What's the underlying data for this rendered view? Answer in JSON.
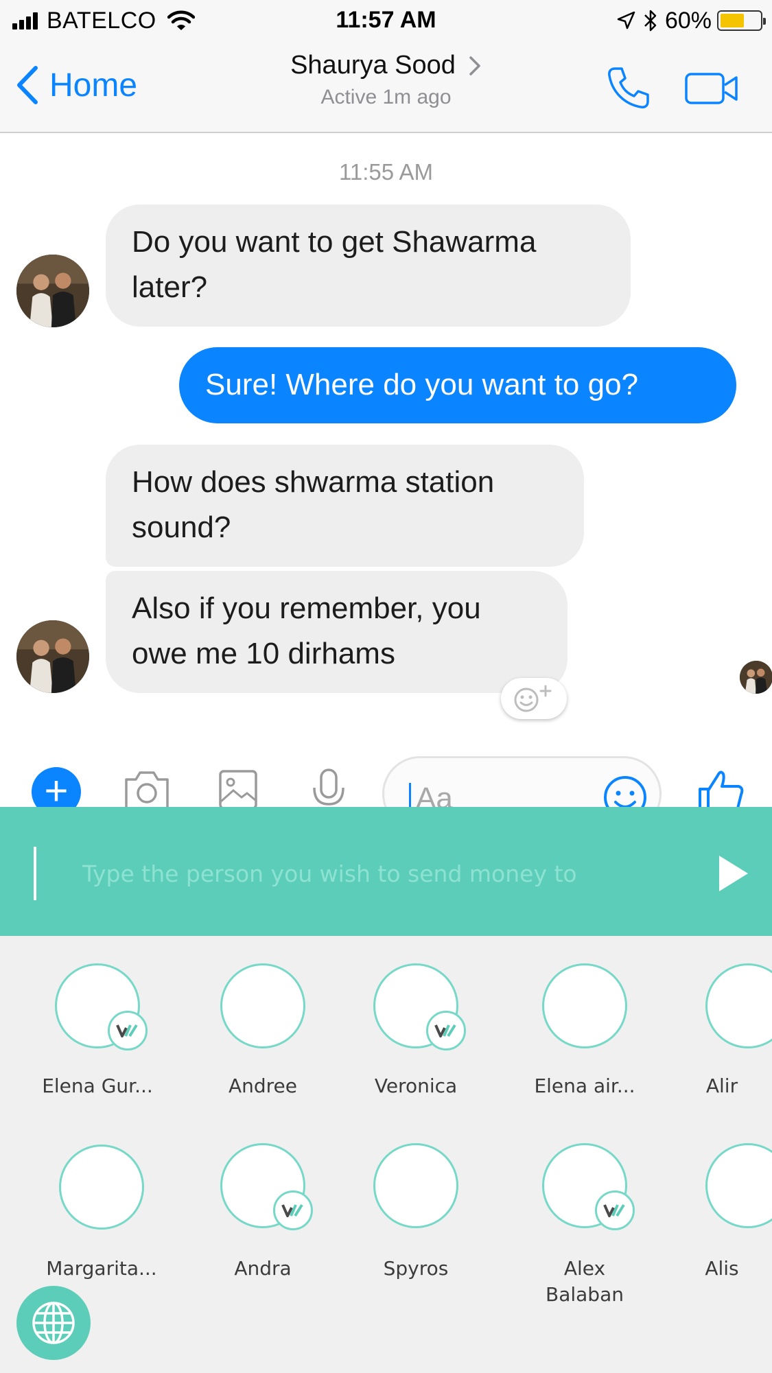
{
  "status_bar": {
    "carrier": "BATELCO",
    "time": "11:57 AM",
    "battery_percent": "60%",
    "battery_level": 0.6,
    "battery_color": "#f4c400"
  },
  "header": {
    "back_label": "Home",
    "contact_name": "Shaurya Sood",
    "contact_status": "Active 1m ago",
    "accent_color": "#0a84ff",
    "icons": [
      "call-icon",
      "video-call-icon"
    ]
  },
  "conversation": {
    "timestamp": "11:55 AM",
    "messages": [
      {
        "from": "them",
        "text": "Do you want to get Shawarma later?"
      },
      {
        "from": "me",
        "text": "Sure! Where do you want to go?"
      },
      {
        "from": "them",
        "text": "How does shwarma station sound?"
      },
      {
        "from": "them",
        "text": "Also if you remember, you owe me 10 dirhams"
      }
    ]
  },
  "composer": {
    "placeholder": "Aa",
    "icons": [
      "plus-icon",
      "camera-icon",
      "gallery-icon",
      "microphone-icon",
      "emoji-icon",
      "thumbs-up-icon"
    ]
  },
  "money_panel": {
    "placeholder": "Type the person you wish to send money to",
    "color": "#5ccdb8",
    "contacts": [
      {
        "name": "Elena Gur...",
        "verified": true
      },
      {
        "name": "Andree",
        "verified": false
      },
      {
        "name": "Veronica",
        "verified": true
      },
      {
        "name": "Elena air...",
        "verified": false
      },
      {
        "name": "Alir",
        "verified": false
      },
      {
        "name": "Margarita...",
        "verified": false
      },
      {
        "name": "Andra",
        "verified": true
      },
      {
        "name": "Spyros",
        "verified": false
      },
      {
        "name": "Alex Balaban",
        "verified": true
      },
      {
        "name": "Alis",
        "verified": false
      }
    ]
  }
}
